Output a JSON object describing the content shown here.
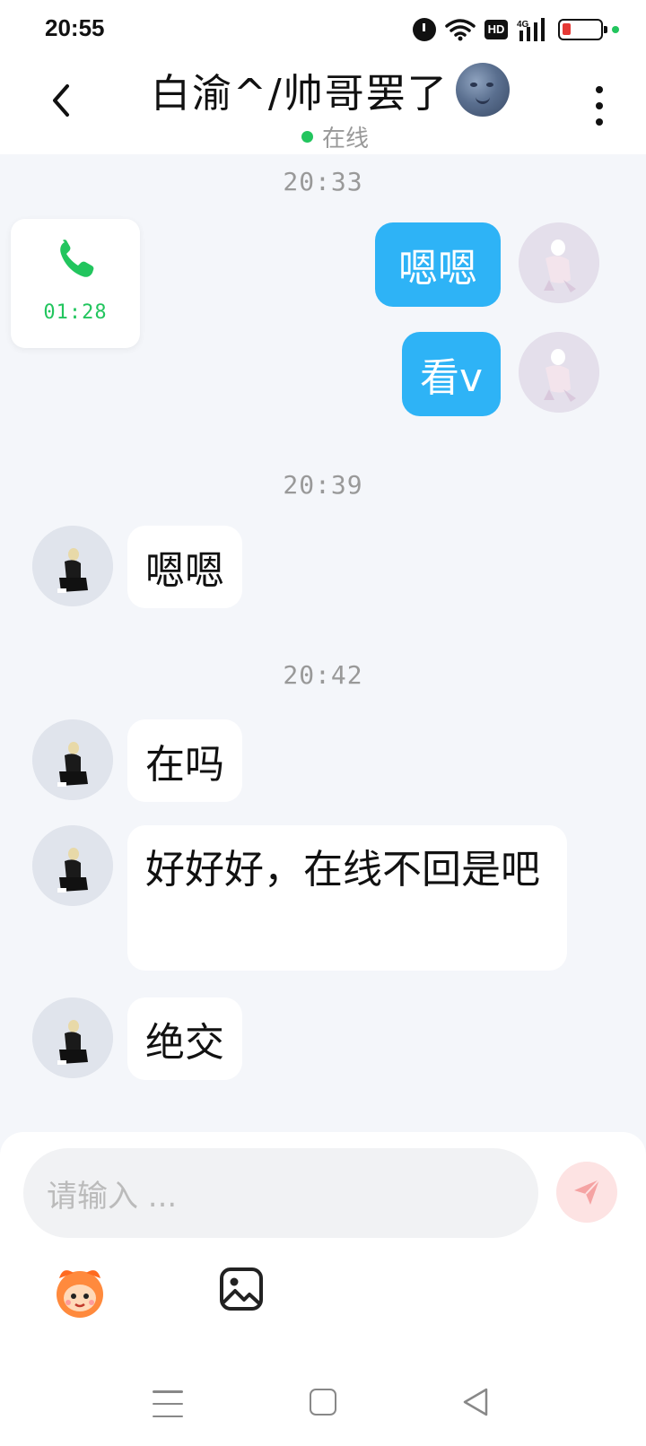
{
  "status_bar": {
    "time": "20:55",
    "icons": [
      "alarm-icon",
      "wifi-icon",
      "hd-icon",
      "signal-4g-icon",
      "battery-low-icon",
      "green-dot"
    ],
    "hd_label": "HD"
  },
  "header": {
    "contact_name": "白渝^/帅哥罢了",
    "status_text": "在线",
    "status_color": "#22c55e"
  },
  "messages": {
    "timestamps": [
      "20:33",
      "20:39",
      "20:42"
    ],
    "call": {
      "duration": "01:28",
      "color": "#22c55e"
    },
    "me": [
      "嗯嗯",
      "看v"
    ],
    "friend": [
      "嗯嗯",
      "在吗",
      "好好好，在线不回是吧",
      "绝交"
    ]
  },
  "composer": {
    "placeholder": "请输入 ...",
    "send_color": "#fde3e3"
  },
  "colors": {
    "bubble_me": "#2eb3f6",
    "background": "#f4f6fa"
  }
}
